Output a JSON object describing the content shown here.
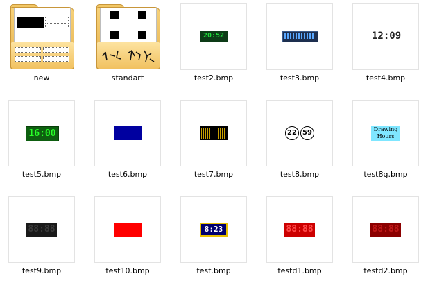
{
  "items": [
    {
      "label": "new",
      "kind": "folder"
    },
    {
      "label": "standart",
      "kind": "folder"
    },
    {
      "label": "test2.bmp",
      "kind": "image",
      "display": "20:52"
    },
    {
      "label": "test3.bmp",
      "kind": "image"
    },
    {
      "label": "test4.bmp",
      "kind": "image",
      "display": "12:09"
    },
    {
      "label": "test5.bmp",
      "kind": "image",
      "display": "16:00"
    },
    {
      "label": "test6.bmp",
      "kind": "image"
    },
    {
      "label": "test7.bmp",
      "kind": "image"
    },
    {
      "label": "test8.bmp",
      "kind": "image",
      "display_hours": "22",
      "display_minutes": "59"
    },
    {
      "label": "test8g.bmp",
      "kind": "image",
      "display_line1": "Drawing",
      "display_line2": "Hours"
    },
    {
      "label": "test9.bmp",
      "kind": "image",
      "display": "88:88"
    },
    {
      "label": "test10.bmp",
      "kind": "image"
    },
    {
      "label": "test.bmp",
      "kind": "image",
      "display": "8:23"
    },
    {
      "label": "testd1.bmp",
      "kind": "image",
      "display": "88:88"
    },
    {
      "label": "testd2.bmp",
      "kind": "image",
      "display": "88:88"
    }
  ],
  "colors": {
    "thumb_border": "#e3e3e3",
    "folder_yellow": "#f2c765",
    "green_lcd_bg": "#0d3b17",
    "green_lcd_fg": "#1fd63a",
    "blue_block": "#0000a0",
    "red_block": "#ff0000",
    "dark_red": "#8b0000",
    "cyan_label": "#7fe6ff"
  },
  "icons": {
    "folder": "folder-icon",
    "image": "bitmap-thumbnail"
  }
}
